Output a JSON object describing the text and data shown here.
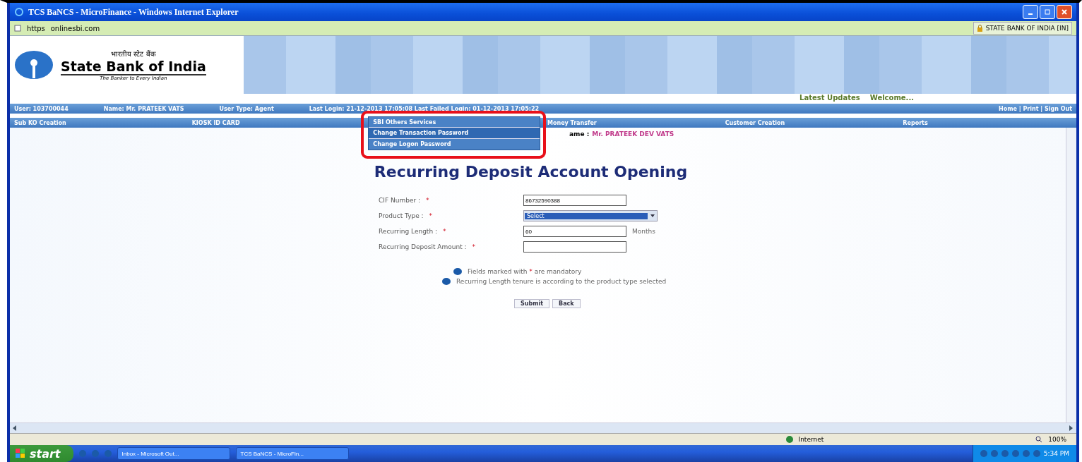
{
  "window": {
    "title": "TCS BaNCS - MicroFinance - Windows Internet Explorer"
  },
  "address_bar": {
    "scheme": "https",
    "domain": "onlinesbi.com",
    "security": "STATE BANK OF INDIA [IN]"
  },
  "logo": {
    "hindi": "भारतीय स्टेट बैंक",
    "name": "State Bank of India",
    "tagline": "The Banker to Every Indian"
  },
  "header_links": [
    "Latest Updates",
    "Welcome..."
  ],
  "user_bar": {
    "items": [
      "User: 103700044",
      "Name: Mr. PRATEEK VATS",
      "User Type: Agent",
      "Last Login: 21-12-2013 17:05:08 Last Failed Login: 01-12-2013 17:05:22"
    ],
    "links": "Home | Print | Sign Out"
  },
  "menu": [
    {
      "label": "Sub KO Creation",
      "open": false
    },
    {
      "label": "KIOSK ID CARD",
      "open": false
    },
    {
      "label": "SBI Others Services",
      "open": true,
      "children": [
        {
          "label": "Change Transaction Password",
          "selected": true
        },
        {
          "label": "Change Logon Password",
          "selected": false
        }
      ]
    },
    {
      "label": "Money Transfer",
      "open": false
    },
    {
      "label": "Customer Creation",
      "open": false
    },
    {
      "label": "Reports",
      "open": false
    }
  ],
  "customer": {
    "label": "ame :",
    "value": "Mr. PRATEEK DEV VATS"
  },
  "form": {
    "title": "Recurring Deposit Account Opening",
    "fields": [
      {
        "kind": "text",
        "label": "CIF Number :",
        "required": true,
        "value": "86732590388"
      },
      {
        "kind": "select",
        "label": "Product Type :",
        "required": true,
        "value": "Select"
      },
      {
        "kind": "text",
        "label": "Recurring Length :",
        "required": true,
        "value": "60",
        "suffix": "Months"
      },
      {
        "kind": "text",
        "label": "Recurring Deposit Amount :",
        "required": true
      }
    ],
    "notes": [
      {
        "parts": [
          "Fields marked with",
          "*",
          "are mandatory"
        ]
      },
      {
        "parts": [
          "Recurring Length tenure is according to the product type selected"
        ]
      }
    ],
    "buttons": [
      "Submit",
      "Back"
    ]
  },
  "status_bar": {
    "zone": "Internet",
    "zoom": "100%"
  },
  "taskbar": {
    "start": "start",
    "tasks": [
      "Inbox - Microsoft Out...",
      "TCS BaNCS - MicroFin..."
    ],
    "clock": "5:34 PM"
  }
}
